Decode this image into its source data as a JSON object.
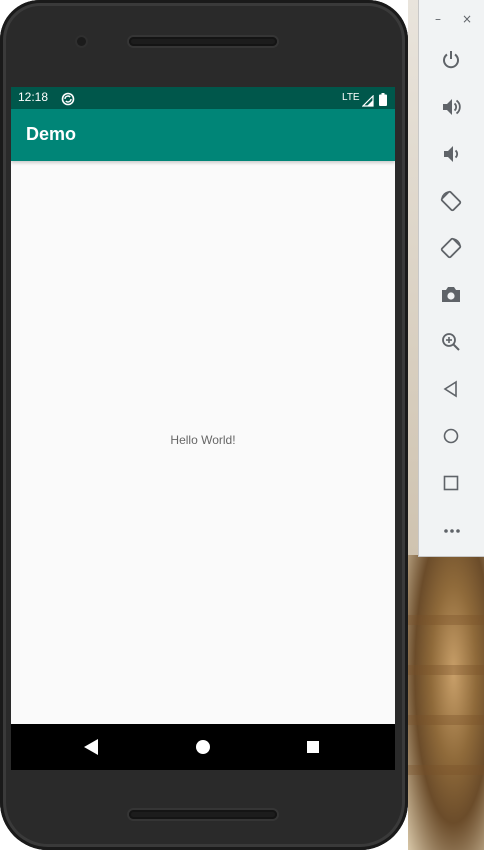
{
  "status_bar": {
    "time": "12:18",
    "network": "LTE",
    "color": "#00574b"
  },
  "app_bar": {
    "title": "Demo",
    "color": "#008577"
  },
  "content": {
    "message": "Hello World!"
  },
  "nav_bar": {
    "icons": [
      "back-icon",
      "home-icon",
      "recents-icon"
    ]
  },
  "emulator_toolbar": {
    "window_controls": {
      "minimize": "–",
      "close": "×"
    },
    "icons": [
      "power-icon",
      "volume-up-icon",
      "volume-down-icon",
      "rotate-left-icon",
      "rotate-right-icon",
      "camera-icon",
      "zoom-icon",
      "back-icon",
      "home-icon",
      "overview-icon",
      "more-icon"
    ],
    "icon_color": "#5f6368"
  }
}
